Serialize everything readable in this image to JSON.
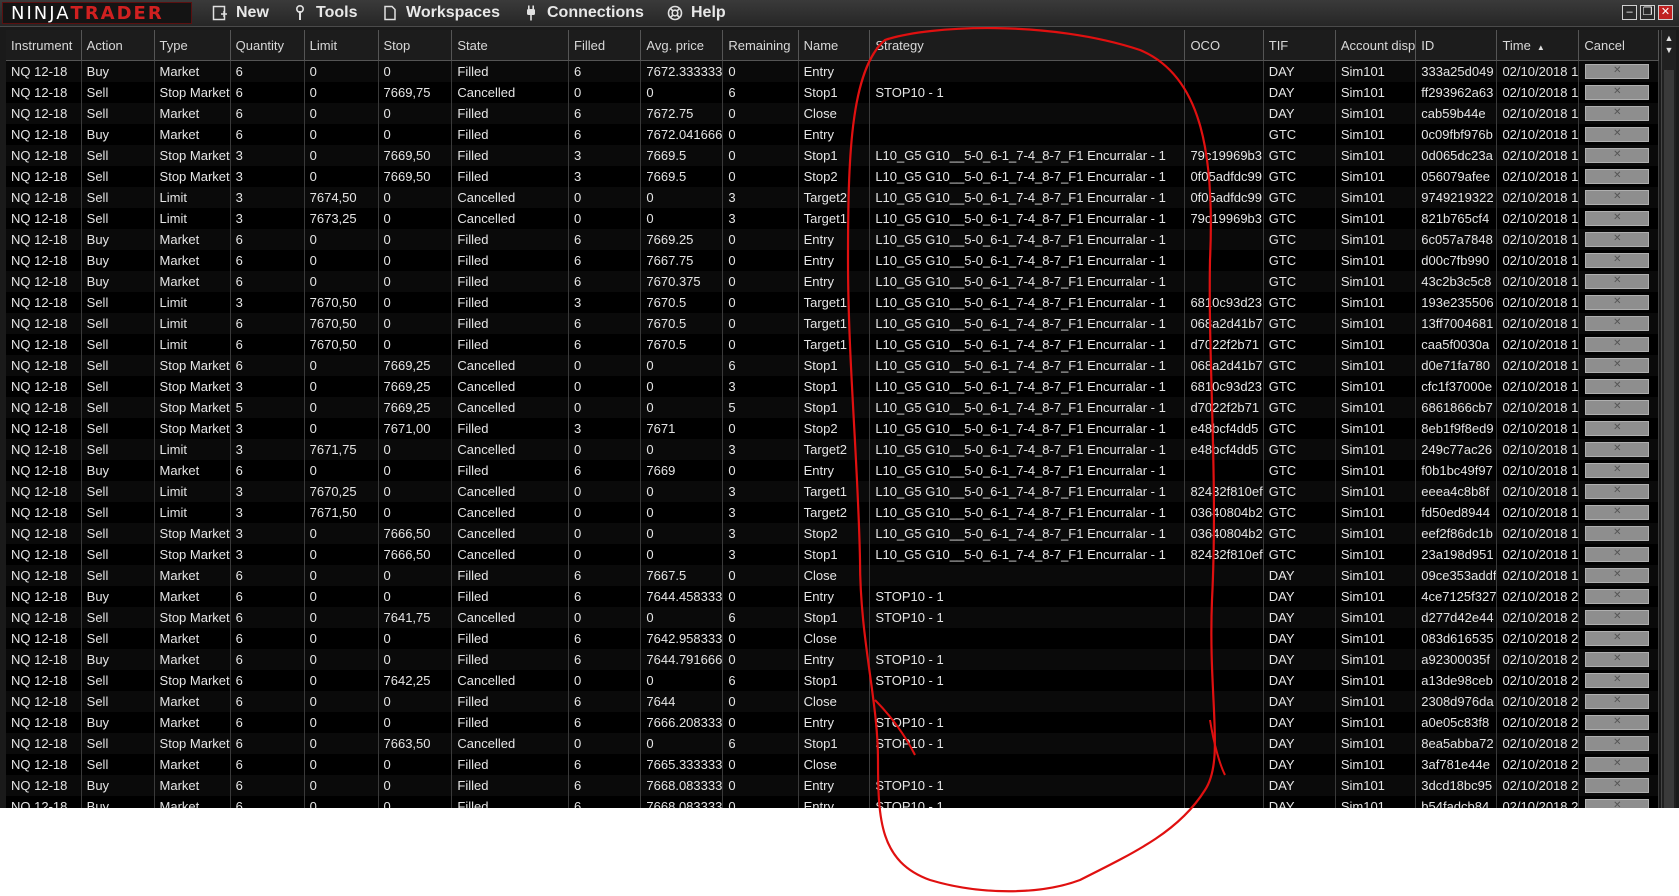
{
  "app": {
    "logo_ninja": "NINJA",
    "logo_trader": "TRADER",
    "menu": [
      {
        "label": "New",
        "icon": "new-window-icon"
      },
      {
        "label": "Tools",
        "icon": "wrench-icon"
      },
      {
        "label": "Workspaces",
        "icon": "document-icon"
      },
      {
        "label": "Connections",
        "icon": "plug-icon"
      },
      {
        "label": "Help",
        "icon": "lifebuoy-icon"
      }
    ],
    "window_buttons": {
      "minimize": "–",
      "restore": "❐",
      "close": "✕"
    }
  },
  "grid": {
    "columns": [
      "Instrument",
      "Action",
      "Type",
      "Quantity",
      "Limit",
      "Stop",
      "State",
      "Filled",
      "Avg. price",
      "Remaining",
      "Name",
      "Strategy",
      "OCO",
      "TIF",
      "Account disp",
      "ID",
      "Time",
      "Cancel"
    ],
    "sorted_column": "Time",
    "cancel_glyph": "✕",
    "rows": [
      [
        "NQ 12-18",
        "Buy",
        "Market",
        "6",
        "0",
        "0",
        "Filled",
        "6",
        "7672.333333",
        "0",
        "Entry",
        "",
        "",
        "DAY",
        "Sim101",
        "333a25d049",
        "02/10/2018 1"
      ],
      [
        "NQ 12-18",
        "Sell",
        "Stop Market",
        "6",
        "0",
        "7669,75",
        "Cancelled",
        "0",
        "0",
        "6",
        "Stop1",
        "STOP10 - 1",
        "",
        "DAY",
        "Sim101",
        "ff293962a63",
        "02/10/2018 1"
      ],
      [
        "NQ 12-18",
        "Sell",
        "Market",
        "6",
        "0",
        "0",
        "Filled",
        "6",
        "7672.75",
        "0",
        "Close",
        "",
        "",
        "DAY",
        "Sim101",
        "cab59b44e",
        "02/10/2018 1"
      ],
      [
        "NQ 12-18",
        "Buy",
        "Market",
        "6",
        "0",
        "0",
        "Filled",
        "6",
        "7672.041666",
        "0",
        "Entry",
        "",
        "",
        "GTC",
        "Sim101",
        "0c09fbf976b",
        "02/10/2018 1"
      ],
      [
        "NQ 12-18",
        "Sell",
        "Stop Market",
        "3",
        "0",
        "7669,50",
        "Filled",
        "3",
        "7669.5",
        "0",
        "Stop1",
        "L10_G5 G10__5-0_6-1_7-4_8-7_F1  Encurralar - 1",
        "79c19969b3",
        "GTC",
        "Sim101",
        "0d065dc23a",
        "02/10/2018 1"
      ],
      [
        "NQ 12-18",
        "Sell",
        "Stop Market",
        "3",
        "0",
        "7669,50",
        "Filled",
        "3",
        "7669.5",
        "0",
        "Stop2",
        "L10_G5 G10__5-0_6-1_7-4_8-7_F1  Encurralar - 1",
        "0f05adfdc99",
        "GTC",
        "Sim101",
        "056079afee",
        "02/10/2018 1"
      ],
      [
        "NQ 12-18",
        "Sell",
        "Limit",
        "3",
        "7674,50",
        "0",
        "Cancelled",
        "0",
        "0",
        "3",
        "Target2",
        "L10_G5 G10__5-0_6-1_7-4_8-7_F1  Encurralar - 1",
        "0f05adfdc99",
        "GTC",
        "Sim101",
        "9749219322",
        "02/10/2018 1"
      ],
      [
        "NQ 12-18",
        "Sell",
        "Limit",
        "3",
        "7673,25",
        "0",
        "Cancelled",
        "0",
        "0",
        "3",
        "Target1",
        "L10_G5 G10__5-0_6-1_7-4_8-7_F1  Encurralar - 1",
        "79c19969b3",
        "GTC",
        "Sim101",
        "821b765cf4",
        "02/10/2018 1"
      ],
      [
        "NQ 12-18",
        "Buy",
        "Market",
        "6",
        "0",
        "0",
        "Filled",
        "6",
        "7669.25",
        "0",
        "Entry",
        "L10_G5 G10__5-0_6-1_7-4_8-7_F1  Encurralar - 1",
        "",
        "GTC",
        "Sim101",
        "6c057a7848",
        "02/10/2018 1"
      ],
      [
        "NQ 12-18",
        "Buy",
        "Market",
        "6",
        "0",
        "0",
        "Filled",
        "6",
        "7667.75",
        "0",
        "Entry",
        "L10_G5 G10__5-0_6-1_7-4_8-7_F1  Encurralar - 1",
        "",
        "GTC",
        "Sim101",
        "d00c7fb990",
        "02/10/2018 1"
      ],
      [
        "NQ 12-18",
        "Buy",
        "Market",
        "6",
        "0",
        "0",
        "Filled",
        "6",
        "7670.375",
        "0",
        "Entry",
        "L10_G5 G10__5-0_6-1_7-4_8-7_F1  Encurralar - 1",
        "",
        "GTC",
        "Sim101",
        "43c2b3c5c8",
        "02/10/2018 1"
      ],
      [
        "NQ 12-18",
        "Sell",
        "Limit",
        "3",
        "7670,50",
        "0",
        "Filled",
        "3",
        "7670.5",
        "0",
        "Target1",
        "L10_G5 G10__5-0_6-1_7-4_8-7_F1  Encurralar - 1",
        "6810c93d23",
        "GTC",
        "Sim101",
        "193e235506",
        "02/10/2018 1"
      ],
      [
        "NQ 12-18",
        "Sell",
        "Limit",
        "6",
        "7670,50",
        "0",
        "Filled",
        "6",
        "7670.5",
        "0",
        "Target1",
        "L10_G5 G10__5-0_6-1_7-4_8-7_F1  Encurralar - 1",
        "068a2d41b7",
        "GTC",
        "Sim101",
        "13ff7004681",
        "02/10/2018 1"
      ],
      [
        "NQ 12-18",
        "Sell",
        "Limit",
        "6",
        "7670,50",
        "0",
        "Filled",
        "6",
        "7670.5",
        "0",
        "Target1",
        "L10_G5 G10__5-0_6-1_7-4_8-7_F1  Encurralar - 1",
        "d7022f2b71",
        "GTC",
        "Sim101",
        "caa5f0030a",
        "02/10/2018 1"
      ],
      [
        "NQ 12-18",
        "Sell",
        "Stop Market",
        "6",
        "0",
        "7669,25",
        "Cancelled",
        "0",
        "0",
        "6",
        "Stop1",
        "L10_G5 G10__5-0_6-1_7-4_8-7_F1  Encurralar - 1",
        "068a2d41b7",
        "GTC",
        "Sim101",
        "d0e71fa780",
        "02/10/2018 1"
      ],
      [
        "NQ 12-18",
        "Sell",
        "Stop Market",
        "3",
        "0",
        "7669,25",
        "Cancelled",
        "0",
        "0",
        "3",
        "Stop1",
        "L10_G5 G10__5-0_6-1_7-4_8-7_F1  Encurralar - 1",
        "6810c93d23",
        "GTC",
        "Sim101",
        "cfc1f37000e",
        "02/10/2018 1"
      ],
      [
        "NQ 12-18",
        "Sell",
        "Stop Market",
        "5",
        "0",
        "7669,25",
        "Cancelled",
        "0",
        "0",
        "5",
        "Stop1",
        "L10_G5 G10__5-0_6-1_7-4_8-7_F1  Encurralar - 1",
        "d7022f2b71",
        "GTC",
        "Sim101",
        "6861866cb7",
        "02/10/2018 1"
      ],
      [
        "NQ 12-18",
        "Sell",
        "Stop Market",
        "3",
        "0",
        "7671,00",
        "Filled",
        "3",
        "7671",
        "0",
        "Stop2",
        "L10_G5 G10__5-0_6-1_7-4_8-7_F1  Encurralar - 1",
        "e48bcf4dd5",
        "GTC",
        "Sim101",
        "8eb1f9f8ed9",
        "02/10/2018 1"
      ],
      [
        "NQ 12-18",
        "Sell",
        "Limit",
        "3",
        "7671,75",
        "0",
        "Cancelled",
        "0",
        "0",
        "3",
        "Target2",
        "L10_G5 G10__5-0_6-1_7-4_8-7_F1  Encurralar - 1",
        "e48bcf4dd5",
        "GTC",
        "Sim101",
        "249c77ac26",
        "02/10/2018 1"
      ],
      [
        "NQ 12-18",
        "Buy",
        "Market",
        "6",
        "0",
        "0",
        "Filled",
        "6",
        "7669",
        "0",
        "Entry",
        "L10_G5 G10__5-0_6-1_7-4_8-7_F1  Encurralar - 1",
        "",
        "GTC",
        "Sim101",
        "f0b1bc49f97",
        "02/10/2018 1"
      ],
      [
        "NQ 12-18",
        "Sell",
        "Limit",
        "3",
        "7670,25",
        "0",
        "Cancelled",
        "0",
        "0",
        "3",
        "Target1",
        "L10_G5 G10__5-0_6-1_7-4_8-7_F1  Encurralar - 1",
        "82432f810ef",
        "GTC",
        "Sim101",
        "eeea4c8b8f",
        "02/10/2018 1"
      ],
      [
        "NQ 12-18",
        "Sell",
        "Limit",
        "3",
        "7671,50",
        "0",
        "Cancelled",
        "0",
        "0",
        "3",
        "Target2",
        "L10_G5 G10__5-0_6-1_7-4_8-7_F1  Encurralar - 1",
        "03640804b2",
        "GTC",
        "Sim101",
        "fd50ed8944",
        "02/10/2018 1"
      ],
      [
        "NQ 12-18",
        "Sell",
        "Stop Market",
        "3",
        "0",
        "7666,50",
        "Cancelled",
        "0",
        "0",
        "3",
        "Stop2",
        "L10_G5 G10__5-0_6-1_7-4_8-7_F1  Encurralar - 1",
        "03640804b2",
        "GTC",
        "Sim101",
        "eef2f86dc1b",
        "02/10/2018 1"
      ],
      [
        "NQ 12-18",
        "Sell",
        "Stop Market",
        "3",
        "0",
        "7666,50",
        "Cancelled",
        "0",
        "0",
        "3",
        "Stop1",
        "L10_G5 G10__5-0_6-1_7-4_8-7_F1  Encurralar - 1",
        "82432f810ef",
        "GTC",
        "Sim101",
        "23a198d951",
        "02/10/2018 1"
      ],
      [
        "NQ 12-18",
        "Sell",
        "Market",
        "6",
        "0",
        "0",
        "Filled",
        "6",
        "7667.5",
        "0",
        "Close",
        "",
        "",
        "DAY",
        "Sim101",
        "09ce353addf",
        "02/10/2018 1"
      ],
      [
        "NQ 12-18",
        "Buy",
        "Market",
        "6",
        "0",
        "0",
        "Filled",
        "6",
        "7644.458333",
        "0",
        "Entry",
        "STOP10 - 1",
        "",
        "DAY",
        "Sim101",
        "4ce7125f327",
        "02/10/2018 2"
      ],
      [
        "NQ 12-18",
        "Sell",
        "Stop Market",
        "6",
        "0",
        "7641,75",
        "Cancelled",
        "0",
        "0",
        "6",
        "Stop1",
        "STOP10 - 1",
        "",
        "DAY",
        "Sim101",
        "d277d42e44",
        "02/10/2018 2"
      ],
      [
        "NQ 12-18",
        "Sell",
        "Market",
        "6",
        "0",
        "0",
        "Filled",
        "6",
        "7642.958333",
        "0",
        "Close",
        "",
        "",
        "DAY",
        "Sim101",
        "083d616535",
        "02/10/2018 2"
      ],
      [
        "NQ 12-18",
        "Buy",
        "Market",
        "6",
        "0",
        "0",
        "Filled",
        "6",
        "7644.791666",
        "0",
        "Entry",
        "STOP10 - 1",
        "",
        "DAY",
        "Sim101",
        "a92300035f",
        "02/10/2018 2"
      ],
      [
        "NQ 12-18",
        "Sell",
        "Stop Market",
        "6",
        "0",
        "7642,25",
        "Cancelled",
        "0",
        "0",
        "6",
        "Stop1",
        "STOP10 - 1",
        "",
        "DAY",
        "Sim101",
        "a13de98ceb",
        "02/10/2018 2"
      ],
      [
        "NQ 12-18",
        "Sell",
        "Market",
        "6",
        "0",
        "0",
        "Filled",
        "6",
        "7644",
        "0",
        "Close",
        "",
        "",
        "DAY",
        "Sim101",
        "2308d976da",
        "02/10/2018 2"
      ],
      [
        "NQ 12-18",
        "Buy",
        "Market",
        "6",
        "0",
        "0",
        "Filled",
        "6",
        "7666.208333",
        "0",
        "Entry",
        "STOP10 - 1",
        "",
        "DAY",
        "Sim101",
        "a0e05c83f8",
        "02/10/2018 2"
      ],
      [
        "NQ 12-18",
        "Sell",
        "Stop Market",
        "6",
        "0",
        "7663,50",
        "Cancelled",
        "0",
        "0",
        "6",
        "Stop1",
        "STOP10 - 1",
        "",
        "DAY",
        "Sim101",
        "8ea5abba72",
        "02/10/2018 2"
      ],
      [
        "NQ 12-18",
        "Sell",
        "Market",
        "6",
        "0",
        "0",
        "Filled",
        "6",
        "7665.333333",
        "0",
        "Close",
        "",
        "",
        "DAY",
        "Sim101",
        "3af781e44e",
        "02/10/2018 2"
      ],
      [
        "NQ 12-18",
        "Buy",
        "Market",
        "6",
        "0",
        "0",
        "Filled",
        "6",
        "7668.083333",
        "0",
        "Entry",
        "STOP10 - 1",
        "",
        "DAY",
        "Sim101",
        "3dcd18bc95",
        "02/10/2018 2"
      ],
      [
        "NQ 12-18",
        "Buy",
        "Market",
        "6",
        "0",
        "0",
        "Filled",
        "6",
        "7668.083333",
        "0",
        "Entry",
        "STOP10 - 1",
        "",
        "DAY",
        "Sim101",
        "b54fadcb84",
        "02/10/2018 2"
      ]
    ]
  },
  "annotation": {
    "color": "#e01010",
    "shape": "hand-drawn loop around Name/Strategy/OCO columns"
  }
}
